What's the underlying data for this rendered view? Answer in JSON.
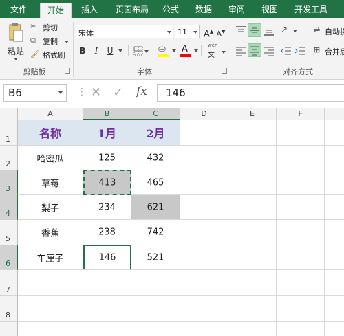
{
  "tabs": [
    "文件",
    "开始",
    "插入",
    "页面布局",
    "公式",
    "数据",
    "审阅",
    "视图",
    "开发工具"
  ],
  "clipboard": {
    "paste": "粘贴",
    "cut": "剪切",
    "copy": "复制",
    "format_painter": "格式刷",
    "group_label": "剪贴板"
  },
  "font": {
    "name": "宋体",
    "size": "11",
    "bold": "B",
    "italic": "I",
    "underline": "U",
    "group_label": "字体",
    "phonetic": "wén"
  },
  "alignment": {
    "wrap": "自动换",
    "merge": "合并后",
    "group_label": "对齐方式"
  },
  "formula_bar": {
    "name_box": "B6",
    "value": "146"
  },
  "columns": [
    "A",
    "B",
    "C",
    "D",
    "E",
    "F"
  ],
  "rows": [
    "1",
    "2",
    "3",
    "4",
    "5",
    "6",
    "7",
    "8"
  ],
  "table": {
    "header": [
      "名称",
      "1月",
      "2月"
    ],
    "rows": [
      [
        "哈密瓜",
        "125",
        "432"
      ],
      [
        "草莓",
        "413",
        "465"
      ],
      [
        "梨子",
        "234",
        "621"
      ],
      [
        "香蕉",
        "238",
        "742"
      ],
      [
        "车厘子",
        "146",
        "521"
      ]
    ]
  },
  "colors": {
    "brand": "#217346",
    "header_fill": "#dce6f1",
    "header_text": "#7030a0",
    "grey_fill": "#c8c8c8"
  }
}
